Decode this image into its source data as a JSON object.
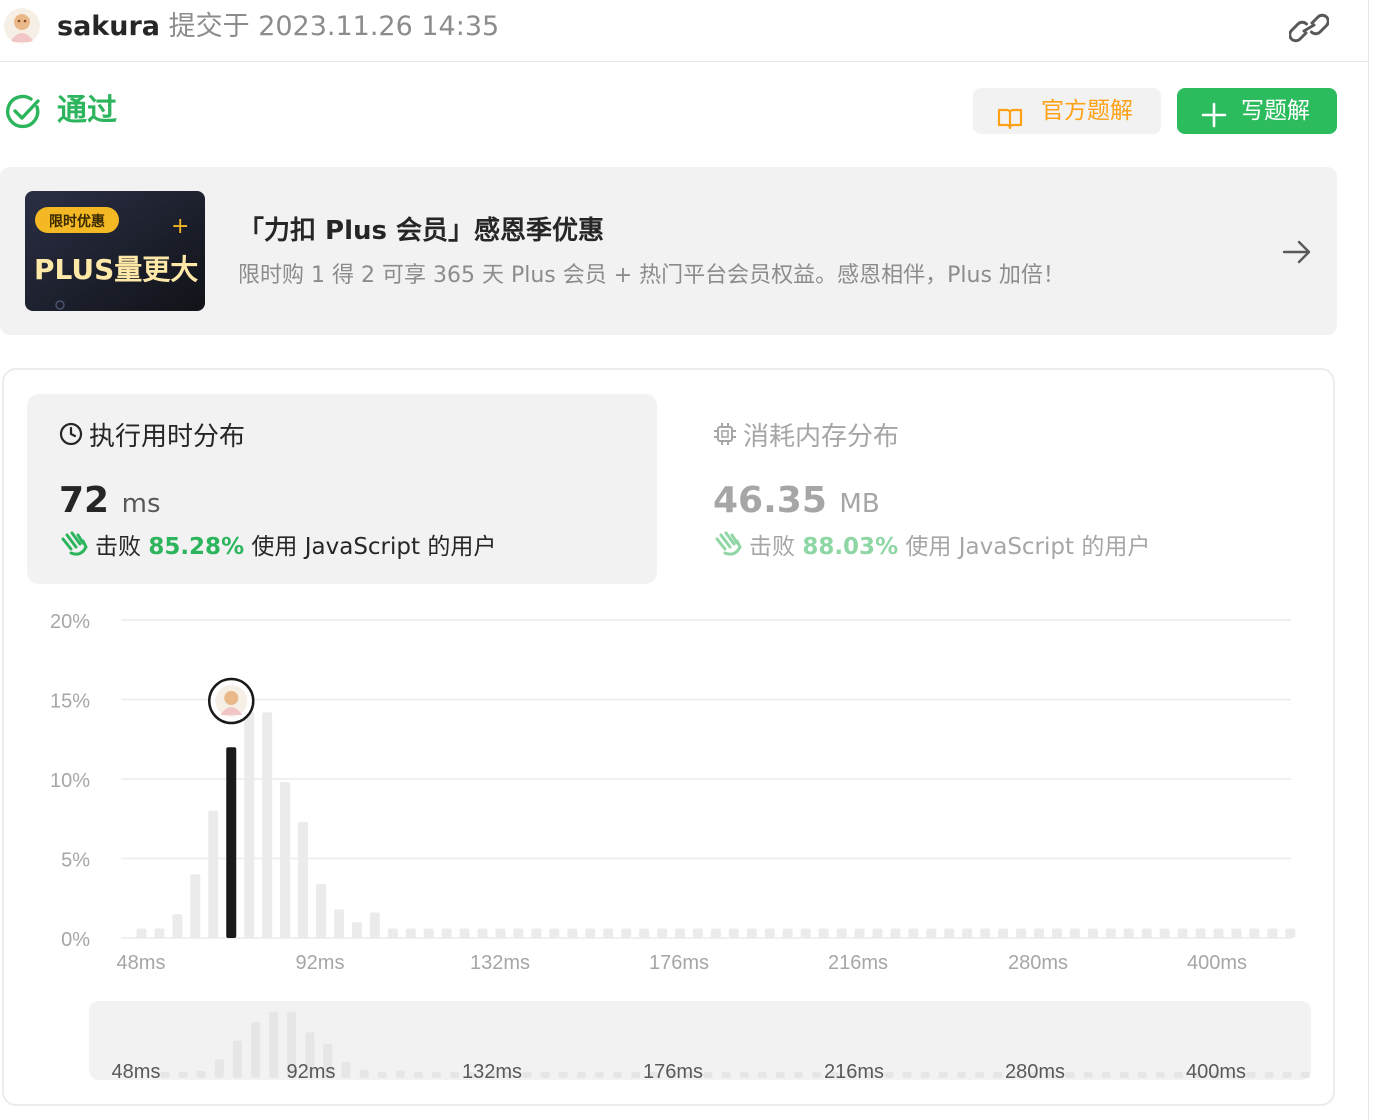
{
  "header": {
    "username": "sakura",
    "submitted_text": "提交于 2023.11.26 14:35",
    "link_icon": "link-icon"
  },
  "status": {
    "label": "通过",
    "color": "#2db55d",
    "icon": "check-circle-icon"
  },
  "actions": {
    "official_solution": "官方题解",
    "write_solution": "写题解"
  },
  "promo": {
    "badge": "限时优惠",
    "image_text": "PLUS量更大",
    "title": "「力扣 Plus 会员」感恩季优惠",
    "description": "限时购 1 得 2 可享 365 天 Plus 会员 + 热门平台会员权益。感恩相伴，Plus 加倍！"
  },
  "runtime": {
    "title": "执行用时分布",
    "value": "72",
    "unit": "ms",
    "beat_prefix": "击败",
    "beat_percent": "85.28%",
    "beat_suffix": "使用 JavaScript 的用户"
  },
  "memory": {
    "title": "消耗内存分布",
    "value": "46.35",
    "unit": "MB",
    "beat_prefix": "击败",
    "beat_percent": "88.03%",
    "beat_suffix": "使用 JavaScript 的用户"
  },
  "colors": {
    "accent": "#2cbb5d",
    "highlight_bar": "#1a1a1a",
    "bar": "#ebebeb",
    "official_text": "#ffa116"
  },
  "chart_data": {
    "type": "bar",
    "title": "",
    "xlabel": "",
    "ylabel": "",
    "ylim": [
      0,
      20
    ],
    "y_ticks": [
      "0%",
      "5%",
      "10%",
      "15%",
      "20%"
    ],
    "x_ticks": [
      "48ms",
      "92ms",
      "132ms",
      "176ms",
      "216ms",
      "280ms",
      "400ms"
    ],
    "selected_index": 5,
    "values": [
      0.6,
      0.6,
      1.5,
      4.0,
      8.0,
      12.0,
      14.2,
      14.2,
      9.8,
      7.3,
      3.4,
      1.8,
      1.0,
      1.6,
      0.6,
      0.6,
      0.6,
      0.6,
      0.6,
      0.6,
      0.6,
      0.6,
      0.6,
      0.6,
      0.6,
      0.6,
      0.6,
      0.6,
      0.6,
      0.6,
      0.6,
      0.6,
      0.6,
      0.6,
      0.6,
      0.6,
      0.6,
      0.6,
      0.6,
      0.6,
      0.6,
      0.6,
      0.6,
      0.6,
      0.6,
      0.6,
      0.6,
      0.6,
      0.6,
      0.6,
      0.6,
      0.6,
      0.6,
      0.6,
      0.6,
      0.6,
      0.6,
      0.6,
      0.6,
      0.6,
      0.6,
      0.6,
      0.6,
      0.6,
      0.6
    ],
    "grid": true
  }
}
